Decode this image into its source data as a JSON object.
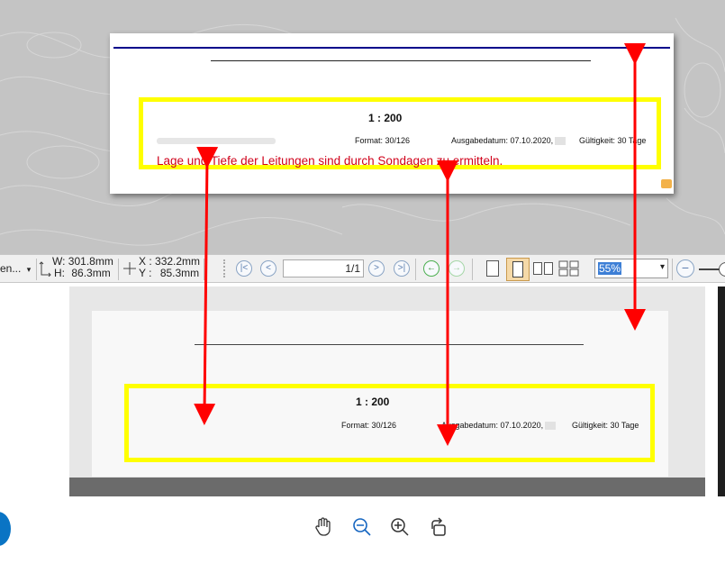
{
  "top_preview": {
    "scale": "1 : 200",
    "format": "Format: 30/126",
    "issue_date": "Ausgabedatum: 07.10.2020,",
    "validity": "Gültigkeit: 30 Tage",
    "note": "Lage und Tiefe der Leitungen sind durch Sondagen zu ermitteln."
  },
  "toolbar": {
    "dropdown_label": "en...",
    "width_label": "W:",
    "width_value": "301.8mm",
    "height_label": "H:",
    "height_value": "86.3mm",
    "x_label": "X :",
    "x_value": "332.2mm",
    "y_label": "Y :",
    "y_value": "85.3mm",
    "page_field": "1/1",
    "zoom_value": "55%"
  },
  "viewer": {
    "scale": "1 : 200",
    "format": "Format: 30/126",
    "issue_date": "Ausgabedatum: 07.10.2020,",
    "validity": "Gültigkeit: 30 Tage"
  },
  "bottom_tools": [
    "hand-icon",
    "zoom-out-icon",
    "zoom-in-icon",
    "rotate-icon"
  ],
  "colors": {
    "highlight": "#ffff00",
    "arrow": "#ff0000",
    "note_text": "#d0021b",
    "blue_rule": "#00008b"
  }
}
